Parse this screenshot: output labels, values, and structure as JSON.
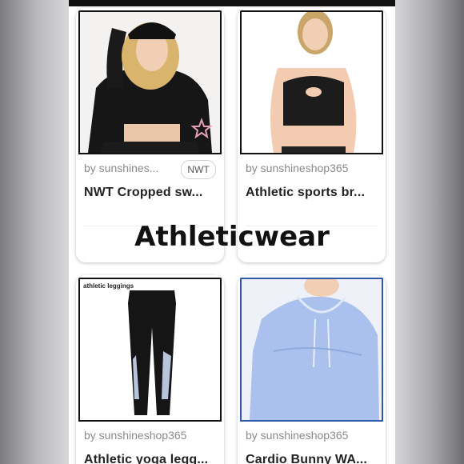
{
  "overlay_title": "Athleticwear",
  "listings": [
    {
      "seller": "by sunshines...",
      "badge": "NWT",
      "title": "NWT Cropped sw..."
    },
    {
      "seller": "by sunshineshop365",
      "title": "Athletic sports br..."
    },
    {
      "seller": "by sunshineshop365",
      "title": "Athletic yoga legg...",
      "image_label": "athletic leggings"
    },
    {
      "seller": "by sunshineshop365",
      "title": "Cardio Bunny WA..."
    }
  ]
}
